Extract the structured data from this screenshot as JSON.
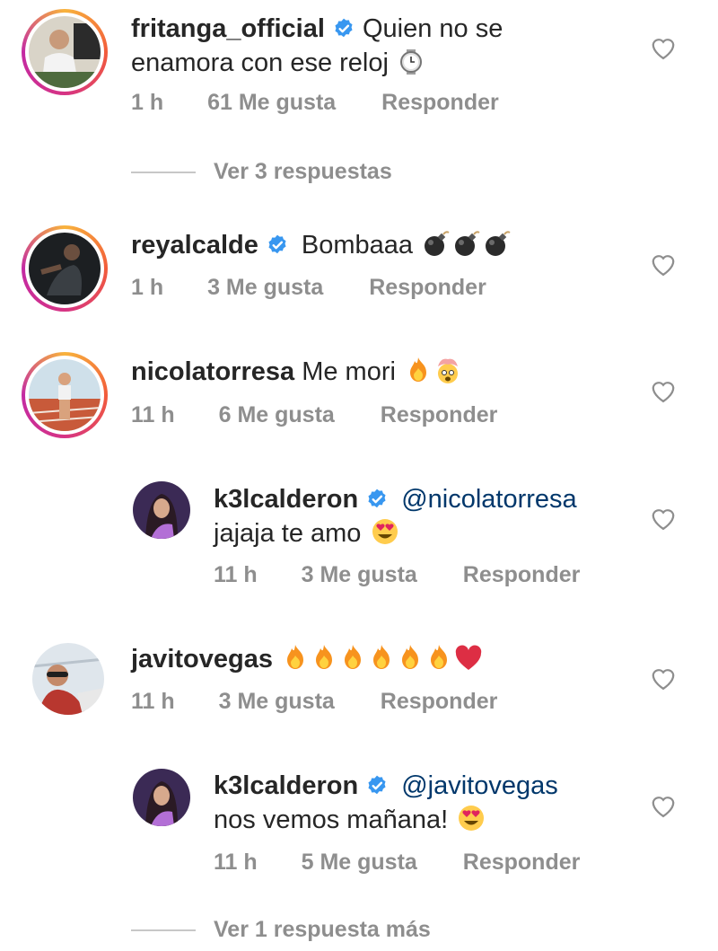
{
  "comments": [
    {
      "username": "fritanga_official",
      "verified": true,
      "text_line1": "Quien no se",
      "text_line2": "enamora con ese reloj",
      "emoji": "watch-emoji",
      "time": "1 h",
      "likes": "61 Me gusta",
      "reply": "Responder",
      "view_replies": "Ver 3 respuestas"
    },
    {
      "username": "reyalcalde",
      "verified": true,
      "text": "Bombaaa",
      "emoji": "bomb-emoji x3",
      "time": "1 h",
      "likes": "3 Me gusta",
      "reply": "Responder"
    },
    {
      "username": "nicolatorresa",
      "verified": false,
      "text": "Me mori",
      "emoji": "fire-emoji, exploding-head-emoji",
      "time": "11 h",
      "likes": "6 Me gusta",
      "reply": "Responder"
    },
    {
      "username": "k3lcalderon",
      "verified": true,
      "mention": "@nicolatorresa",
      "text": "jajaja te amo",
      "emoji": "heart-eyes-emoji",
      "time": "11 h",
      "likes": "3 Me gusta",
      "reply": "Responder",
      "is_reply": true
    },
    {
      "username": "javitovegas",
      "verified": false,
      "text": "",
      "emoji": "fire-emoji x6, red-heart-emoji",
      "time": "11 h",
      "likes": "3 Me gusta",
      "reply": "Responder"
    },
    {
      "username": "k3lcalderon",
      "verified": true,
      "mention": "@javitovegas",
      "text": "nos vemos mañana!",
      "emoji": "heart-eyes-emoji",
      "time": "11 h",
      "likes": "5 Me gusta",
      "reply": "Responder",
      "is_reply": true,
      "view_replies": "Ver 1 respuesta más"
    }
  ],
  "colors": {
    "username": "#262626",
    "meta": "#8e8e8e",
    "mention": "#00376b",
    "verified": "#3897f0",
    "story_ring_start": "#f8b33c",
    "story_ring_end": "#c32aa3"
  }
}
